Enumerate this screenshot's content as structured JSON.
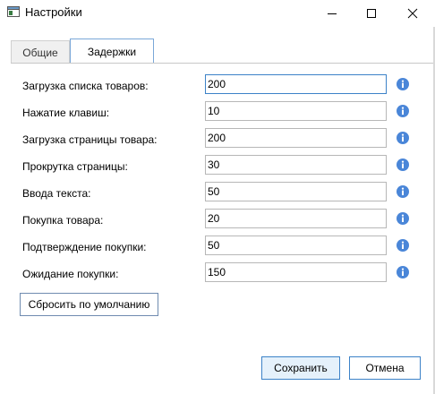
{
  "window": {
    "title": "Настройки"
  },
  "tabs": [
    {
      "label": "Общие",
      "active": false
    },
    {
      "label": "Задержки",
      "active": true
    }
  ],
  "fields": [
    {
      "label": "Загрузка списка товаров:",
      "value": "200"
    },
    {
      "label": "Нажатие клавиш:",
      "value": "10"
    },
    {
      "label": "Загрузка страницы товара:",
      "value": "200"
    },
    {
      "label": "Прокрутка страницы:",
      "value": "30"
    },
    {
      "label": "Ввода текста:",
      "value": "50"
    },
    {
      "label": "Покупка товара:",
      "value": "20"
    },
    {
      "label": "Подтверждение покупки:",
      "value": "50"
    },
    {
      "label": "Ожидание покупки:",
      "value": "150"
    }
  ],
  "buttons": {
    "reset": "Сбросить по умолчанию",
    "save": "Сохранить",
    "cancel": "Отмена"
  },
  "colors": {
    "info_icon": "#4a86d8",
    "accent": "#3c82c8"
  }
}
